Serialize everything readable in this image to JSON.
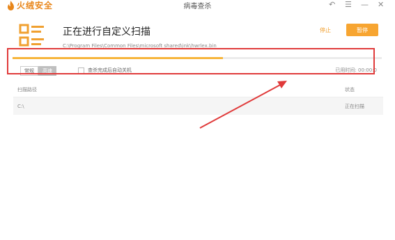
{
  "app": {
    "brand": "火绒安全",
    "window_title": "病毒查杀"
  },
  "window_controls": {
    "back": "↶",
    "menu": "☰",
    "minimize": "—",
    "close": "✕"
  },
  "scan": {
    "title": "正在进行自定义扫描",
    "current_path": "C:\\Program Files\\Common Files\\microsoft shared\\ink\\hwrlex.bin",
    "stop_label": "停止",
    "pause_label": "暂停",
    "progress": 0.57
  },
  "options": {
    "modes": [
      "常规",
      "高速"
    ],
    "selected_mode": "高速",
    "auto_shutdown_label": "查杀完成后自动关机",
    "elapsed_label": "已用时间:",
    "elapsed_value": "00:00:0"
  },
  "table": {
    "headers": [
      "扫描路径",
      "状态"
    ],
    "rows": [
      {
        "path": "C:\\",
        "status": "正在扫描"
      }
    ]
  },
  "colors": {
    "accent": "#f7a531",
    "annotation": "#e03a3a"
  }
}
